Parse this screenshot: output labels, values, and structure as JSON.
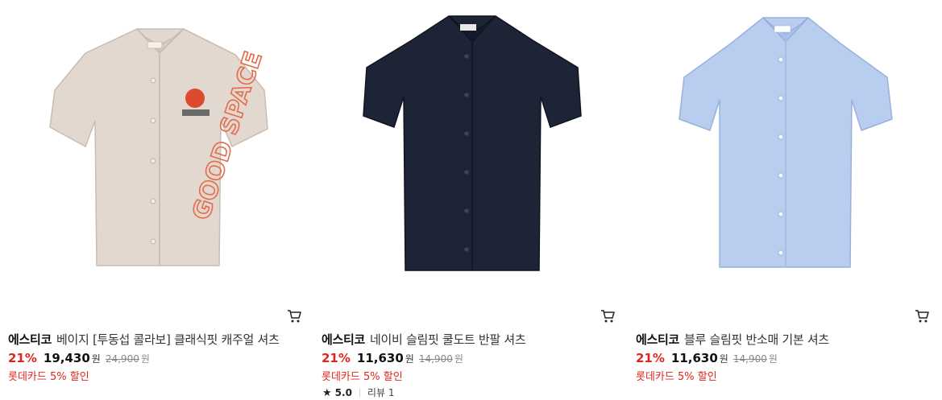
{
  "products": [
    {
      "brand": "에스티코",
      "name": "베이지 [투동섭 콜라보] 클래식핏 캐주얼 셔츠",
      "discount": "21%",
      "price": "19,430",
      "price_unit": "원",
      "original_price": "24,900",
      "original_unit": "원",
      "promo": "롯데카드 5% 할인",
      "shirt_color": "#e3d8cf",
      "graphic_text": "GOOD SPACE",
      "cart_icon": "cart-icon"
    },
    {
      "brand": "에스티코",
      "name": "네이비 슬림핏 쿨도트 반팔 셔츠",
      "discount": "21%",
      "price": "11,630",
      "price_unit": "원",
      "original_price": "14,900",
      "original_unit": "원",
      "promo": "롯데카드 5% 할인",
      "rating": "5.0",
      "review_label": "리뷰 1",
      "shirt_color": "#1d2436",
      "cart_icon": "cart-icon"
    },
    {
      "brand": "에스티코",
      "name": "블루 슬림핏 반소매 기본 셔츠",
      "discount": "21%",
      "price": "11,630",
      "price_unit": "원",
      "original_price": "14,900",
      "original_unit": "원",
      "promo": "롯데카드 5% 할인",
      "shirt_color": "#b9cdef",
      "cart_icon": "cart-icon"
    }
  ],
  "colors": {
    "discount_red": "#e0261c",
    "text_dark": "#111111",
    "strike_gray": "#888888"
  }
}
